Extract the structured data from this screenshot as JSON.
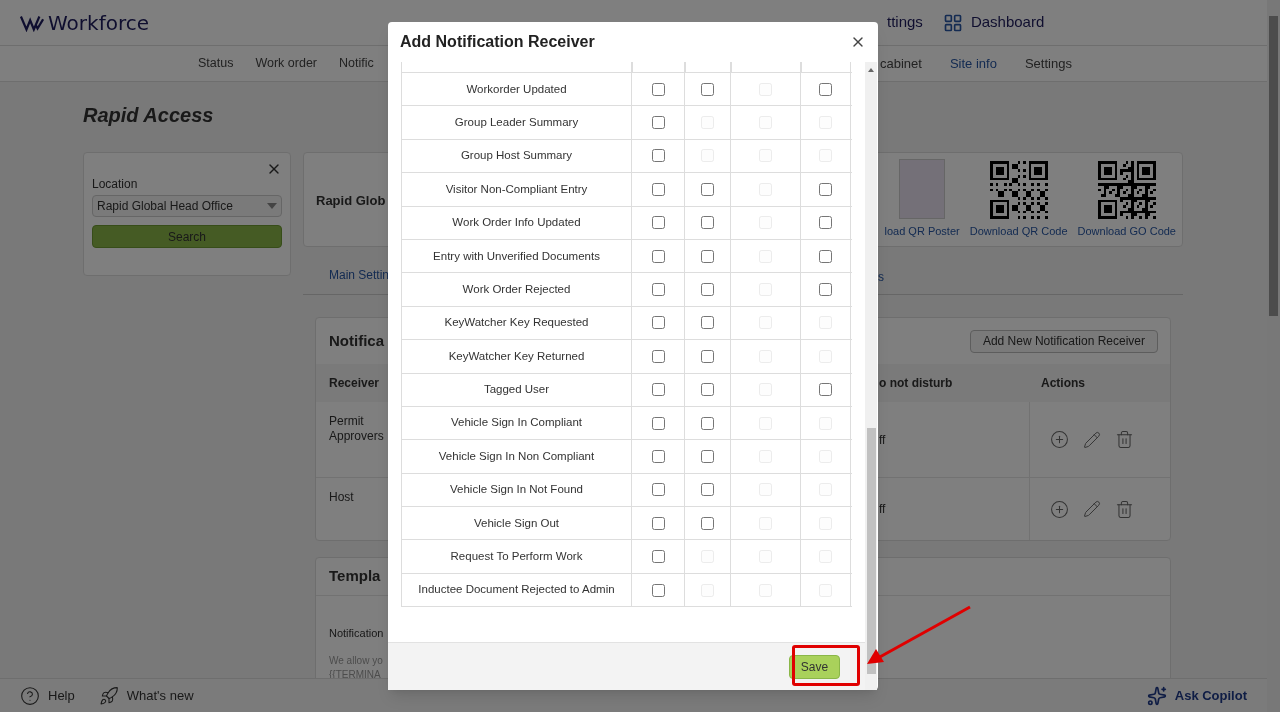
{
  "app": {
    "logo": "Workforce",
    "nav": [
      {
        "label": "ttings",
        "kind": "text"
      },
      {
        "label": "Dashboard",
        "kind": "grid"
      }
    ]
  },
  "subnav_left": [
    {
      "label": "Status",
      "selected": false
    },
    {
      "label": "Work order",
      "selected": false
    },
    {
      "label": "Notific",
      "selected": false
    }
  ],
  "subnav_right": [
    {
      "label": "cabinet",
      "selected": false
    },
    {
      "label": "Site info",
      "selected": true
    },
    {
      "label": "Settings",
      "selected": false
    }
  ],
  "page_title": "Rapid Access",
  "location_panel": {
    "label": "Location",
    "value": "Rapid Global Head Office",
    "button": "Search"
  },
  "site_card": {
    "name": "Rapid Glob",
    "downloads": [
      {
        "kind": "poster",
        "label": "load QR Poster"
      },
      {
        "kind": "qr",
        "label": "Download QR Code"
      },
      {
        "kind": "qr",
        "label": "Download GO Code"
      }
    ]
  },
  "settings_tabs": [
    "Main Settin",
    "s"
  ],
  "notifications_card": {
    "title": "Notifica",
    "add_button": "Add New Notification Receiver",
    "columns": [
      "Receiver",
      "o not disturb",
      "Actions"
    ],
    "rows": [
      {
        "receiver": "Permit Approvers",
        "do_not_disturb": "ff"
      },
      {
        "receiver": "Host",
        "do_not_disturb": "ff"
      }
    ]
  },
  "templates_card": {
    "title": "Templa",
    "field_label": "Notification",
    "help_lines": [
      "We allow yo",
      "{{TERMINA"
    ]
  },
  "footer": {
    "help": "Help",
    "whats_new": "What's new",
    "copilot": "Ask Copilot"
  },
  "modal": {
    "title": "Add Notification Receiver",
    "save": "Save",
    "rows": [
      {
        "label": "Workorder Updated",
        "checks": [
          {
            "checked": false,
            "disabled": false
          },
          {
            "checked": false,
            "disabled": false
          },
          {
            "checked": false,
            "disabled": true
          },
          {
            "checked": false,
            "disabled": false
          }
        ]
      },
      {
        "label": "Group Leader Summary",
        "checks": [
          {
            "checked": false,
            "disabled": false
          },
          {
            "checked": false,
            "disabled": true
          },
          {
            "checked": false,
            "disabled": true
          },
          {
            "checked": false,
            "disabled": true
          }
        ]
      },
      {
        "label": "Group Host Summary",
        "checks": [
          {
            "checked": false,
            "disabled": false
          },
          {
            "checked": false,
            "disabled": true
          },
          {
            "checked": false,
            "disabled": true
          },
          {
            "checked": false,
            "disabled": true
          }
        ]
      },
      {
        "label": "Visitor Non-Compliant Entry",
        "checks": [
          {
            "checked": false,
            "disabled": false
          },
          {
            "checked": false,
            "disabled": false
          },
          {
            "checked": false,
            "disabled": true
          },
          {
            "checked": false,
            "disabled": false
          }
        ]
      },
      {
        "label": "Work Order Info Updated",
        "checks": [
          {
            "checked": false,
            "disabled": false
          },
          {
            "checked": false,
            "disabled": false
          },
          {
            "checked": false,
            "disabled": true
          },
          {
            "checked": false,
            "disabled": false
          }
        ]
      },
      {
        "label": "Entry with Unverified Documents",
        "checks": [
          {
            "checked": false,
            "disabled": false
          },
          {
            "checked": false,
            "disabled": false
          },
          {
            "checked": false,
            "disabled": true
          },
          {
            "checked": false,
            "disabled": false
          }
        ]
      },
      {
        "label": "Work Order Rejected",
        "checks": [
          {
            "checked": false,
            "disabled": false
          },
          {
            "checked": false,
            "disabled": false
          },
          {
            "checked": false,
            "disabled": true
          },
          {
            "checked": false,
            "disabled": false
          }
        ]
      },
      {
        "label": "KeyWatcher Key Requested",
        "checks": [
          {
            "checked": false,
            "disabled": false
          },
          {
            "checked": false,
            "disabled": false
          },
          {
            "checked": false,
            "disabled": true
          },
          {
            "checked": false,
            "disabled": true
          }
        ]
      },
      {
        "label": "KeyWatcher Key Returned",
        "checks": [
          {
            "checked": false,
            "disabled": false
          },
          {
            "checked": false,
            "disabled": false
          },
          {
            "checked": false,
            "disabled": true
          },
          {
            "checked": false,
            "disabled": true
          }
        ]
      },
      {
        "label": "Tagged User",
        "checks": [
          {
            "checked": false,
            "disabled": false
          },
          {
            "checked": false,
            "disabled": false
          },
          {
            "checked": false,
            "disabled": true
          },
          {
            "checked": false,
            "disabled": false
          }
        ]
      },
      {
        "label": "Vehicle Sign In Compliant",
        "checks": [
          {
            "checked": false,
            "disabled": false
          },
          {
            "checked": false,
            "disabled": false
          },
          {
            "checked": false,
            "disabled": true
          },
          {
            "checked": false,
            "disabled": true
          }
        ]
      },
      {
        "label": "Vehicle Sign In Non Compliant",
        "checks": [
          {
            "checked": false,
            "disabled": false
          },
          {
            "checked": false,
            "disabled": false
          },
          {
            "checked": false,
            "disabled": true
          },
          {
            "checked": false,
            "disabled": true
          }
        ]
      },
      {
        "label": "Vehicle Sign In Not Found",
        "checks": [
          {
            "checked": false,
            "disabled": false
          },
          {
            "checked": false,
            "disabled": false
          },
          {
            "checked": false,
            "disabled": true
          },
          {
            "checked": false,
            "disabled": true
          }
        ]
      },
      {
        "label": "Vehicle Sign Out",
        "checks": [
          {
            "checked": false,
            "disabled": false
          },
          {
            "checked": false,
            "disabled": false
          },
          {
            "checked": false,
            "disabled": true
          },
          {
            "checked": false,
            "disabled": true
          }
        ]
      },
      {
        "label": "Request To Perform Work",
        "checks": [
          {
            "checked": false,
            "disabled": false
          },
          {
            "checked": false,
            "disabled": true
          },
          {
            "checked": false,
            "disabled": true
          },
          {
            "checked": false,
            "disabled": true
          }
        ]
      },
      {
        "label": "Inductee Document Rejected to Admin",
        "checks": [
          {
            "checked": false,
            "disabled": false
          },
          {
            "checked": false,
            "disabled": true
          },
          {
            "checked": false,
            "disabled": true
          },
          {
            "checked": false,
            "disabled": true
          }
        ]
      }
    ]
  }
}
